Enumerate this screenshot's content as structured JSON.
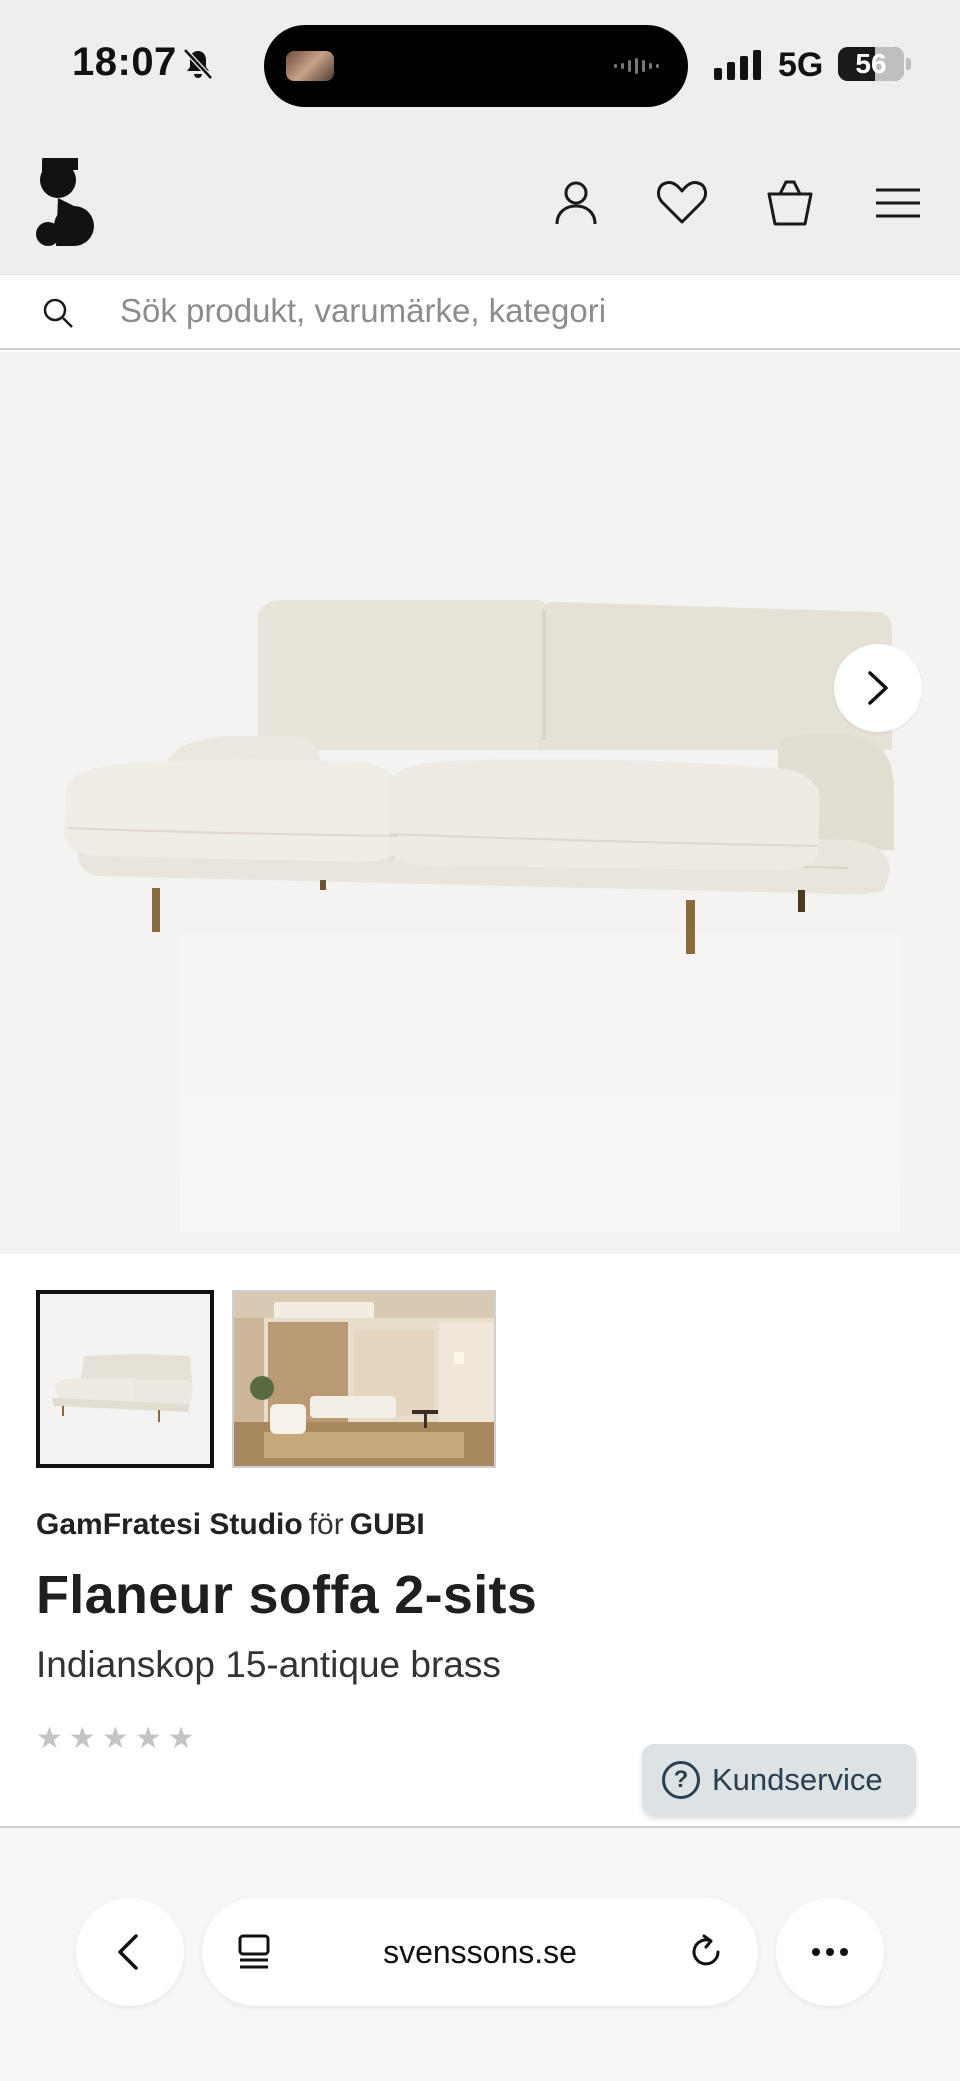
{
  "status_bar": {
    "time": "18:07",
    "network": "5G",
    "battery": "56",
    "battery_level_percent": 56
  },
  "header": {
    "logo_alt": "S",
    "icons": [
      "user-icon",
      "heart-icon",
      "basket-icon",
      "menu-icon"
    ]
  },
  "search": {
    "placeholder": "Sök produkt, varumärke, kategori"
  },
  "gallery": {
    "images": [
      "sofa-product-image",
      "sofa-room-image"
    ],
    "next_icon": "chevron-right-icon"
  },
  "product": {
    "designer": "GamFratesi Studio",
    "for_word": "för",
    "brand": "GUBI",
    "title": "Flaneur soffa 2-sits",
    "variant": "Indianskop 15-antique brass",
    "rating_stars": [
      "★",
      "★",
      "★",
      "★",
      "★"
    ],
    "rating_filled": 0
  },
  "support": {
    "label": "Kundservice"
  },
  "browser": {
    "url": "svenssons.se",
    "icons": [
      "back-icon",
      "tabs-icon",
      "reload-icon",
      "more-icon"
    ]
  },
  "colors": {
    "header_bg": "#efeeec",
    "gallery_bg": "#f4f3f2",
    "support_bg": "#dde2e4",
    "support_text": "#2a3f4f"
  }
}
